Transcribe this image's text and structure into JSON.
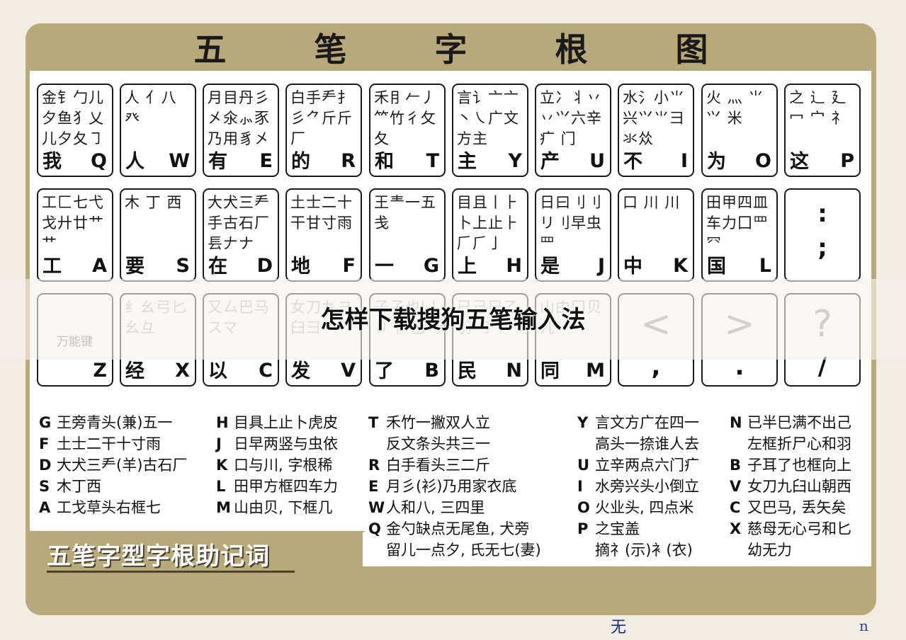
{
  "chart_title": [
    "五",
    "笔",
    "字",
    "根",
    "图"
  ],
  "headline": "怎样下载搜狗五笔输入法",
  "helper_title": "五笔字型字根助记词",
  "watermark_fragments": [
    "无",
    "n"
  ],
  "rows": [
    [
      {
        "roots": "金钅勹儿夕鱼犭乂儿夕夂㇆",
        "main": "我",
        "letter": "Q"
      },
      {
        "roots": "人 亻八 癶",
        "main": "人",
        "letter": "W"
      },
      {
        "roots": "月目丹彡㐅氽⺗豕乃用豸㐅",
        "main": "有",
        "letter": "E"
      },
      {
        "roots": "白手龵扌彡⺈斤斤厂",
        "main": "的",
        "letter": "R"
      },
      {
        "roots": "禾⺝𠂉丿⺮竹彳攵夂",
        "main": "和",
        "letter": "T"
      },
      {
        "roots": "言讠亠亠丶㇏广文方主",
        "main": "主",
        "letter": "Y"
      },
      {
        "roots": "立冫丬丷丷⺍六辛疒 门",
        "main": "产",
        "letter": "U"
      },
      {
        "roots": "水氵小⺌兴⺍⺌⺕氺𠈌",
        "main": "不",
        "letter": "I"
      },
      {
        "roots": "火 灬 ⺌⺍ 米",
        "main": "为",
        "letter": "O"
      },
      {
        "roots": "之 辶 廴冖 宀 礻",
        "main": "这",
        "letter": "P"
      }
    ],
    [
      {
        "roots": "工匚七弋戈廾廿艹艹",
        "main": "工",
        "letter": "A"
      },
      {
        "roots": "木 丁 西",
        "main": "要",
        "letter": "S"
      },
      {
        "roots": "大犬三龵手古石厂镸𠂇ナ",
        "main": "在",
        "letter": "D"
      },
      {
        "roots": "土士二十干甘寸雨",
        "main": "地",
        "letter": "F"
      },
      {
        "roots": "王龶一五戋",
        "main": "一",
        "letter": "G"
      },
      {
        "roots": "目且丨⺊卜上止⺊𠂆⺁亅",
        "main": "上",
        "letter": "H"
      },
      {
        "roots": "日曰刂刂リ刂早虫罒",
        "main": "是",
        "letter": "J"
      },
      {
        "roots": "口 川 川",
        "main": "中",
        "letter": "K"
      },
      {
        "roots": "田甲四皿车力囗罒㓁",
        "main": "国",
        "letter": "L"
      },
      {
        "symbols": [
          ":",
          ";"
        ]
      }
    ],
    [
      {
        "special": "万能键",
        "letter": "Z"
      },
      {
        "roots": "纟幺弓匕幺彑",
        "main": "经",
        "letter": "X"
      },
      {
        "roots": "又厶巴马スマ",
        "main": "以",
        "letter": "C"
      },
      {
        "roots": "女刀九ヨ臼彐",
        "main": "发",
        "letter": "V"
      },
      {
        "roots": "子孑也凵 卩 阝巳《",
        "main": "了",
        "letter": "B"
      },
      {
        "roots": "已己巳乙 羽 ㇆ 𠃜",
        "main": "民",
        "letter": "N"
      },
      {
        "roots": "山由囗贝几",
        "main": "同",
        "letter": "M"
      },
      {
        "sym_top": "<",
        "sym_bottom": ","
      },
      {
        "sym_top": ">",
        "sym_bottom": "."
      },
      {
        "sym_top": "?",
        "sym_bottom": "/"
      }
    ]
  ],
  "mnemonics": [
    [
      {
        "k": "G",
        "t": "王旁青头(兼)五一"
      },
      {
        "k": "F",
        "t": "土士二干十寸雨"
      },
      {
        "k": "D",
        "t": "大犬三龵(羊)古石厂"
      },
      {
        "k": "S",
        "t": "木丁西"
      },
      {
        "k": "A",
        "t": "工戈草头右框七"
      }
    ],
    [
      {
        "k": "H",
        "t": "目具上止卜虎皮"
      },
      {
        "k": "J",
        "t": "日早两竖与虫依"
      },
      {
        "k": "K",
        "t": "口与川, 字根稀"
      },
      {
        "k": "L",
        "t": "田甲方框四车力"
      },
      {
        "k": "M",
        "t": "山由贝, 下框几"
      }
    ],
    [
      {
        "k": "T",
        "t": "禾竹一撇双人立"
      },
      {
        "k": "",
        "t": "反文条头共三一"
      },
      {
        "k": "R",
        "t": "白手看头三二斤"
      },
      {
        "k": "E",
        "t": "月彡(衫)乃用家衣底"
      },
      {
        "k": "W",
        "t": "人和八, 三四里"
      },
      {
        "k": "Q",
        "t": "金勺缺点无尾鱼, 犬旁"
      },
      {
        "k": "",
        "t": "留儿一点夕, 氏无七(妻)"
      }
    ],
    [
      {
        "k": "Y",
        "t": "言文方广在四一"
      },
      {
        "k": "",
        "t": "高头一捺谁人去"
      },
      {
        "k": "U",
        "t": "立辛两点六门疒"
      },
      {
        "k": "I",
        "t": "水旁兴头小倒立"
      },
      {
        "k": "O",
        "t": "火业头, 四点米"
      },
      {
        "k": "P",
        "t": "之宝盖"
      },
      {
        "k": "",
        "t": "摘礻(示)衤(衣)"
      }
    ],
    [
      {
        "k": "N",
        "t": "已半巳满不出己"
      },
      {
        "k": "",
        "t": "左框折尸心和羽"
      },
      {
        "k": "B",
        "t": "子耳了也框向上"
      },
      {
        "k": "V",
        "t": "女刀九臼山朝西"
      },
      {
        "k": "C",
        "t": "又巴马, 丢矢矣"
      },
      {
        "k": "X",
        "t": "慈母无心弓和匕"
      },
      {
        "k": "",
        "t": "幼无力"
      }
    ]
  ]
}
